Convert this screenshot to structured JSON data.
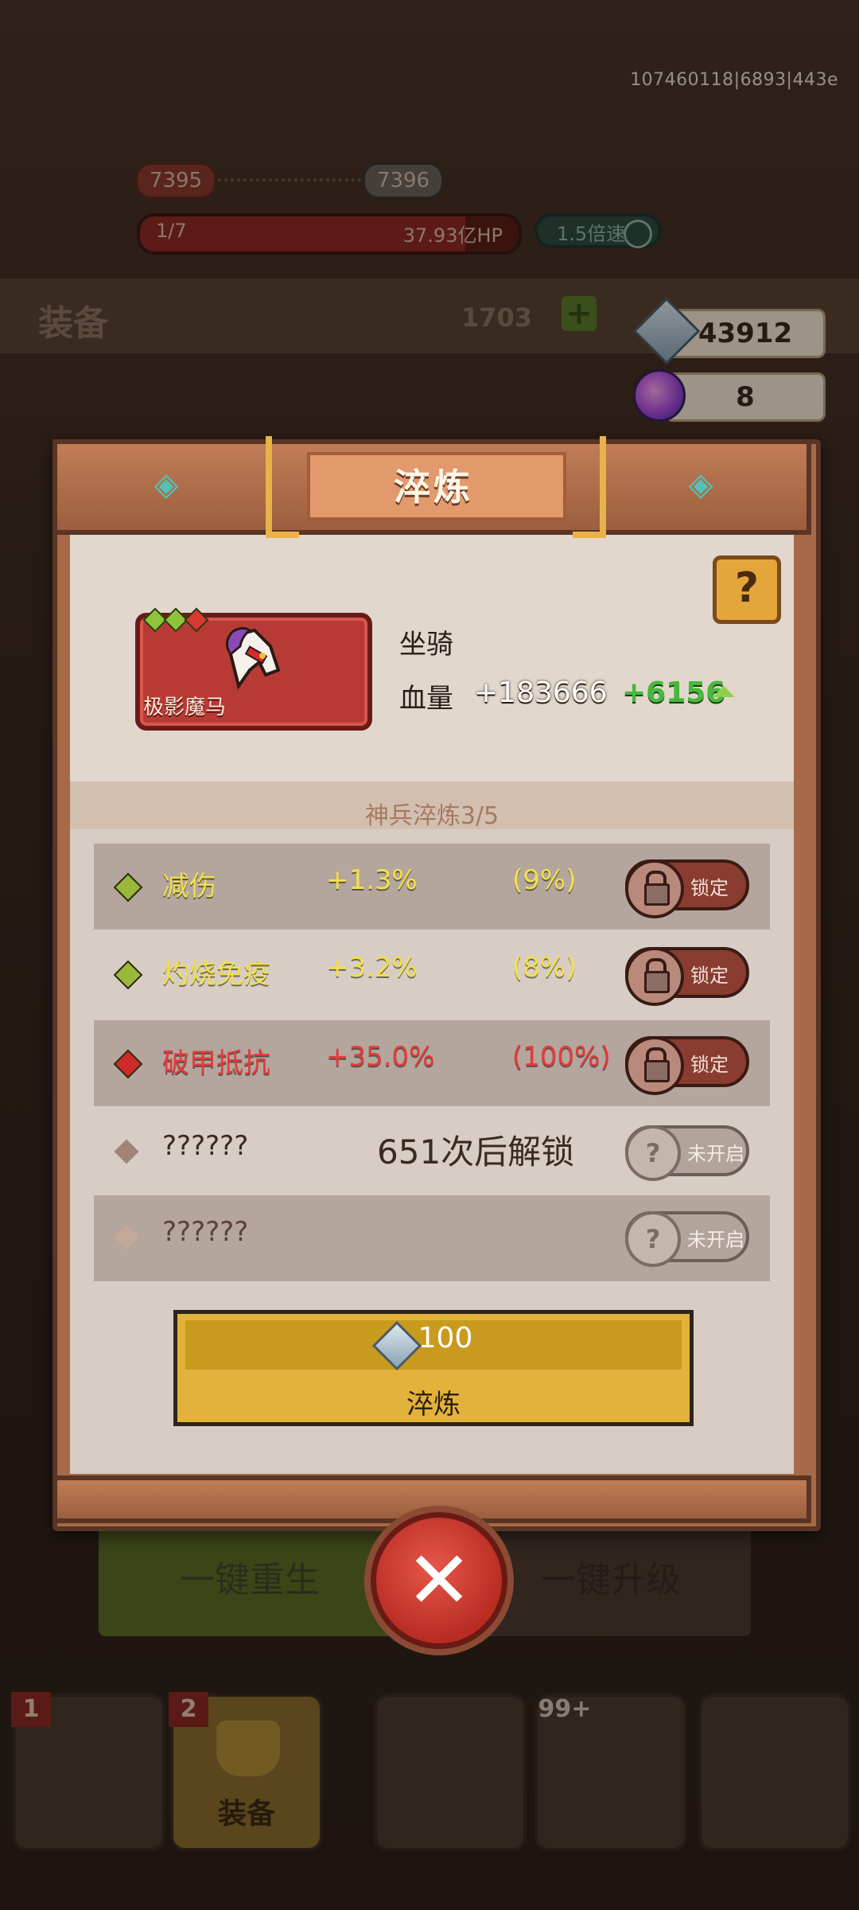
{
  "build_id": "107460118|6893|443e",
  "hud": {
    "level_current": "7395",
    "level_next": "7396",
    "wave": "1/7",
    "boss_hp": "37.93亿HP",
    "boss_hp_fraction": 0.86,
    "speed": "1.5倍速"
  },
  "equip_bar": {
    "title": "装备",
    "count": "1703"
  },
  "resources": {
    "gems": "43912",
    "orbs": "8"
  },
  "background_buttons": {
    "rebirth": "一键重生",
    "upgrade": "一键升级"
  },
  "bottom_tabs": [
    {
      "badge": "1",
      "label": ""
    },
    {
      "badge": "2",
      "label": "装备"
    },
    {
      "badge": "",
      "label": ""
    },
    {
      "badge": "99+",
      "label": ""
    },
    {
      "badge": "",
      "label": ""
    }
  ],
  "modal": {
    "title": "淬炼",
    "help_label": "?",
    "item": {
      "name": "极影魔马",
      "type": "坐骑",
      "stat_label": "血量",
      "stat_value": "+183666",
      "stat_increase": "+6156",
      "star_colors": [
        "#8fc43a",
        "#8fc43a",
        "#d63a30"
      ]
    },
    "refine_progress": "神兵淬炼3/5",
    "affixes": [
      {
        "name": "减伤",
        "value": "+1.3%",
        "chance": "(9%)",
        "color": "#f2e04a",
        "gem_color": "#9ab83a",
        "button": "锁定",
        "locked": true
      },
      {
        "name": "灼烧免疫",
        "value": "+3.2%",
        "chance": "(8%)",
        "color": "#f2e04a",
        "gem_color": "#9ab83a",
        "button": "锁定",
        "locked": true
      },
      {
        "name": "破甲抵抗",
        "value": "+35.0%",
        "chance": "(100%)",
        "color": "#e63a3a",
        "gem_color": "#d02a2a",
        "button": "锁定",
        "locked": true
      },
      {
        "name": "??????",
        "unlock_text": "651次后解锁",
        "button": "未开启",
        "locked": false
      },
      {
        "name": "??????",
        "unlock_text": "",
        "button": "未开启",
        "locked": false
      }
    ],
    "refine_button": {
      "cost": "100",
      "label": "淬炼"
    },
    "close_label": "✕"
  }
}
